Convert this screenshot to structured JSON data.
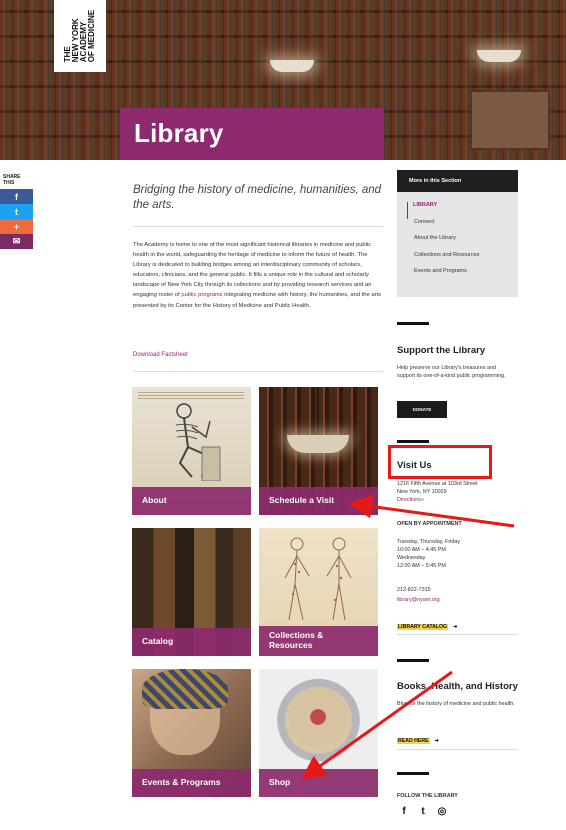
{
  "logo": {
    "lines": [
      "THE",
      "NEW YORK",
      "ACADEMY",
      "OF MEDICINE"
    ]
  },
  "hero": {
    "title": "Library"
  },
  "share": {
    "label": "SHARE THIS",
    "buttons": [
      "f",
      "t",
      "+",
      "✉"
    ]
  },
  "main": {
    "intro": "Bridging the history of medicine, humanities, and the arts.",
    "body_before_link": "The Academy is home to one of the most significant historical libraries in medicine and public health in the world, safeguarding the heritage of medicine to inform the future of health. The Library is dedicated to building bridges among an interdisciplinary community of scholars, educators, clinicians, and the general public. It fills a unique role in the cultural and scholarly landscape of New York City through its collections and by providing research services and an engaging roster of ",
    "body_link": "public programs",
    "body_after_link": " integrating medicine with history, the humanities, and the arts presented by its Center for the History of Medicine and Public Health.",
    "factsheet": "Download Factsheet"
  },
  "tiles": [
    {
      "label": "About"
    },
    {
      "label": "Schedule a Visit"
    },
    {
      "label": "Catalog"
    },
    {
      "label": "Collections & Resources"
    },
    {
      "label": "Events & Programs"
    },
    {
      "label": "Shop"
    }
  ],
  "sidebar": {
    "more": {
      "heading": "More in this Section",
      "items": [
        "LIBRARY",
        "Connect",
        "About the Library",
        "Collections and Resources",
        "Events and Programs"
      ]
    },
    "support": {
      "heading": "Support the Library",
      "text": "Help preserve our Library's treasures and support its one-of-a-kind public programming.",
      "button": "DONATE"
    },
    "visit": {
      "heading": "Visit Us",
      "address": "1216 Fifth Avenue at 103rd Street",
      "city": "New York, NY 10029",
      "directions": "Directions»",
      "appointment": "OPEN BY APPOINTMENT",
      "days1": "Tuesday, Thursday, Friday",
      "hours1": "10:00 AM – 4:45 PM",
      "days2": "Wednesday",
      "hours2": "12:00 AM – 5:45 PM",
      "phone": "212-822-7315",
      "email": "library@nyam.org",
      "catalog_link": "LIBRARY CATALOG"
    },
    "books": {
      "heading": "Books, Health, and History",
      "text": "Blog for the history of medicine and public health.",
      "read_link": "READ HERE"
    },
    "follow": {
      "label": "FOLLOW THE LIBRARY",
      "icons": [
        "f",
        "t",
        "◎"
      ]
    }
  },
  "colors": {
    "brand": "#8c2a6d",
    "annotation": "#e3191a"
  },
  "icons": [
    "facebook-icon",
    "twitter-icon",
    "plus-icon",
    "mail-icon",
    "arrow-right-icon",
    "instagram-icon"
  ]
}
